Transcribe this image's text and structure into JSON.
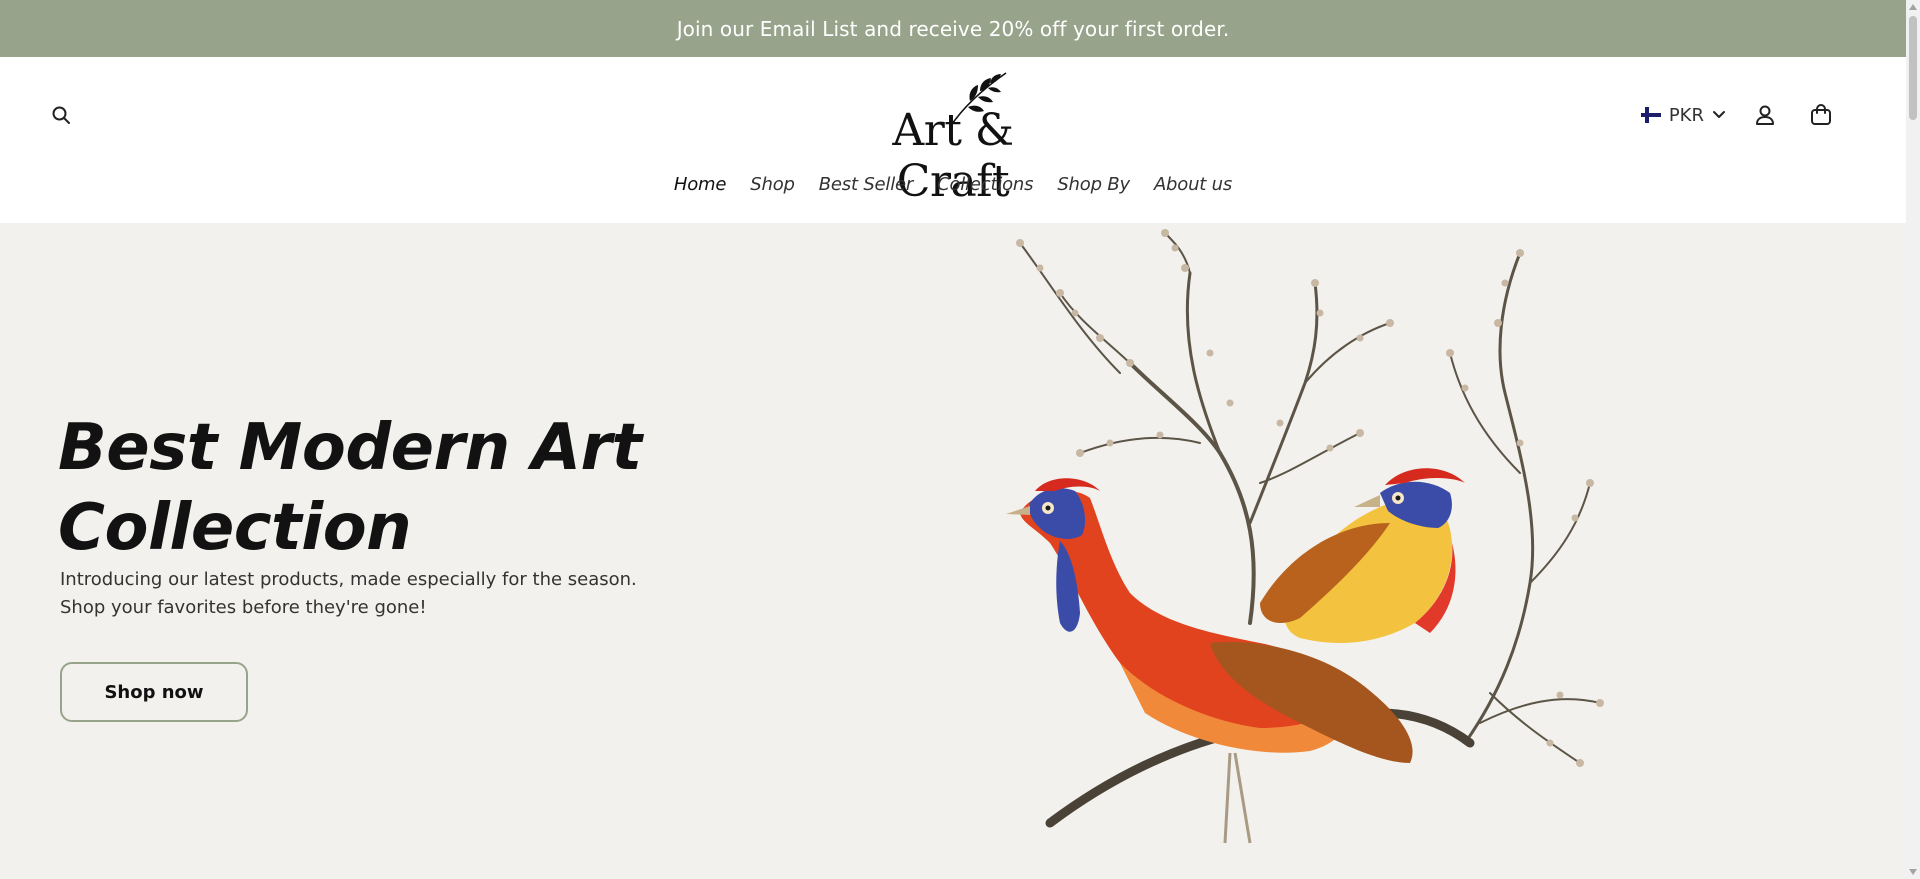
{
  "announcement": {
    "text": "Join our Email List and receive 20% off your first order."
  },
  "header": {
    "logo_text": "Art & Craft",
    "nav": [
      {
        "label": "Home"
      },
      {
        "label": "Shop"
      },
      {
        "label": "Best Seller"
      },
      {
        "label": "Collections"
      },
      {
        "label": "Shop By"
      },
      {
        "label": "About us"
      }
    ],
    "currency": "PKR",
    "icons": {
      "search": "search-icon",
      "flag": "flag-icon",
      "chevron": "chevron-down-icon",
      "account": "account-icon",
      "cart": "cart-icon"
    }
  },
  "hero": {
    "title_line1": "Best Modern Art",
    "title_line2": "Collection",
    "desc_line1": "Introducing our latest products, made especially for the season.",
    "desc_line2": "Shop your favorites before they're gone!",
    "cta": "Shop now",
    "image": "two-pheasants-on-branch-illustration"
  },
  "colors": {
    "announcement_bg": "#97a38a",
    "hero_bg": "#f2f1ed",
    "button_border": "#97a38a",
    "text": "#121212"
  }
}
